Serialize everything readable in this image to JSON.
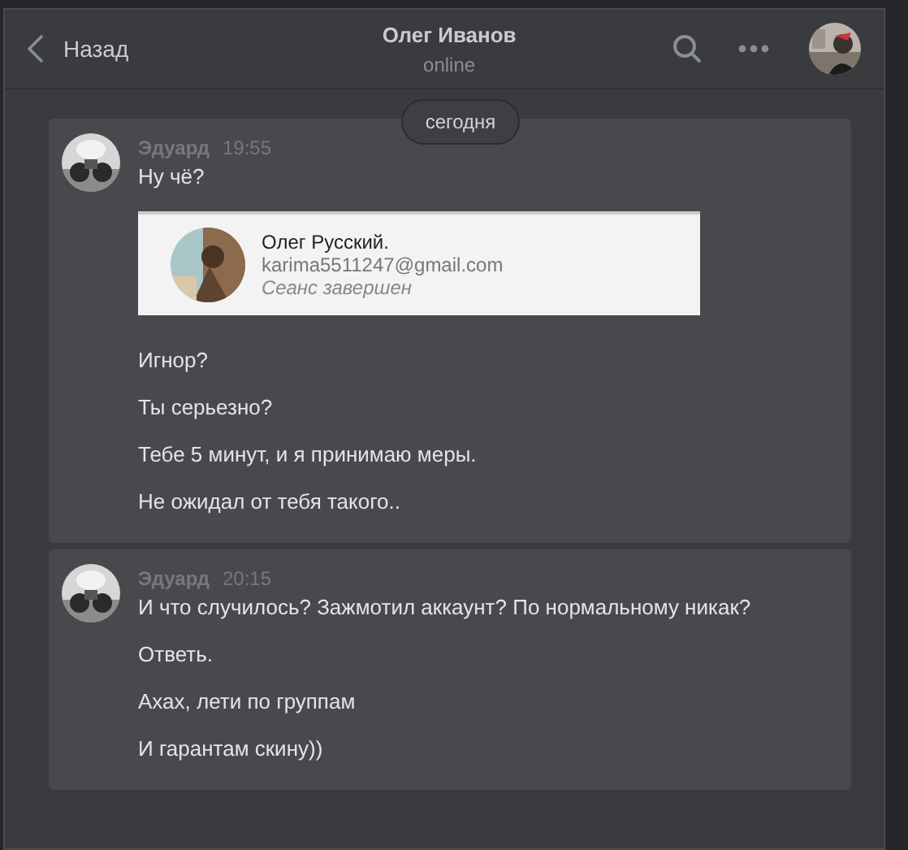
{
  "header": {
    "back_label": "Назад",
    "title": "Олег Иванов",
    "status": "online"
  },
  "date_divider": "сегодня",
  "messages": [
    {
      "author": "Эдуард",
      "time": "19:55",
      "items": [
        {
          "kind": "text",
          "text": "Ну чё?"
        },
        {
          "kind": "screenshot",
          "name": "Олег Русский.",
          "email": "karima5511247@gmail.com",
          "note": "Сеанс завершен"
        },
        {
          "kind": "text",
          "text": "Игнор?"
        },
        {
          "kind": "text",
          "text": "Ты серьезно?"
        },
        {
          "kind": "text",
          "text": "Тебе 5 минут, и я принимаю меры."
        },
        {
          "kind": "text",
          "text": "Не ожидал от тебя такого.."
        }
      ]
    },
    {
      "author": "Эдуард",
      "time": "20:15",
      "items": [
        {
          "kind": "text",
          "text": "И что случилось? Зажмотил аккаунт? По нормальному никак?"
        },
        {
          "kind": "text",
          "text": "Ответь."
        },
        {
          "kind": "text",
          "text": "Ахах, лети по группам"
        },
        {
          "kind": "text",
          "text": "И гарантам скину))"
        }
      ]
    }
  ]
}
